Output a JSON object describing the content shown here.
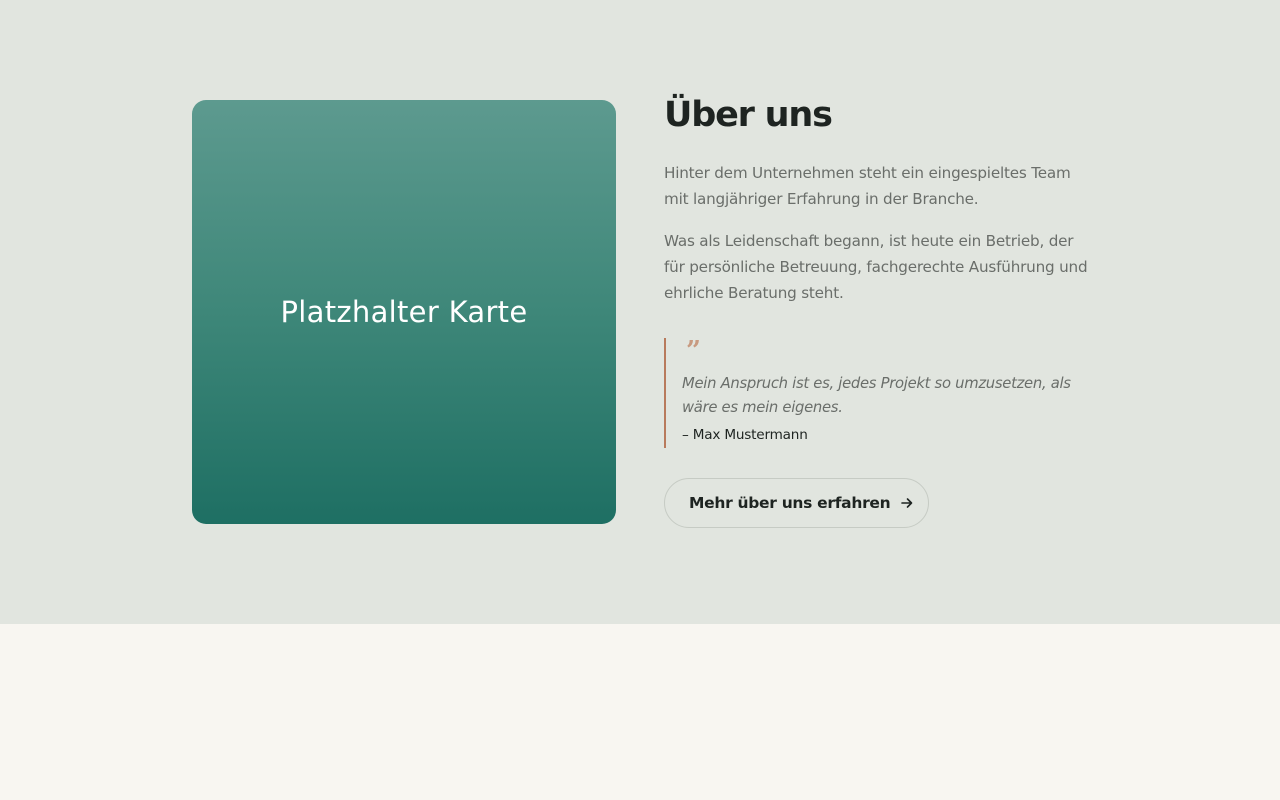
{
  "about": {
    "image_placeholder": "Platzhalter Karte",
    "title": "Über uns",
    "paragraphs": [
      "Hinter dem Unternehmen steht ein eingespieltes Team mit langjähriger Erfahrung in der Branche.",
      "Was als Leidenschaft begann, ist heute ein Betrieb, der für persönliche Betreuung, fachgerechte Ausführung und ehrliche Beratung steht."
    ],
    "quote": {
      "mark": "”",
      "text": "Mein Anspruch ist es, jedes Projekt so umzusetzen, als wäre es mein eigenes.",
      "author": "– Max Mustermann"
    },
    "cta": {
      "label": "Mehr über uns erfahren",
      "icon": "arrow-right-icon"
    }
  },
  "colors": {
    "section_background": "#e1e5df",
    "page_background": "#f8f6f1",
    "accent_teal": "#1e6f63",
    "quote_accent": "#b87a5c",
    "heading": "#1e2421",
    "body_text": "#6a6e6a"
  }
}
